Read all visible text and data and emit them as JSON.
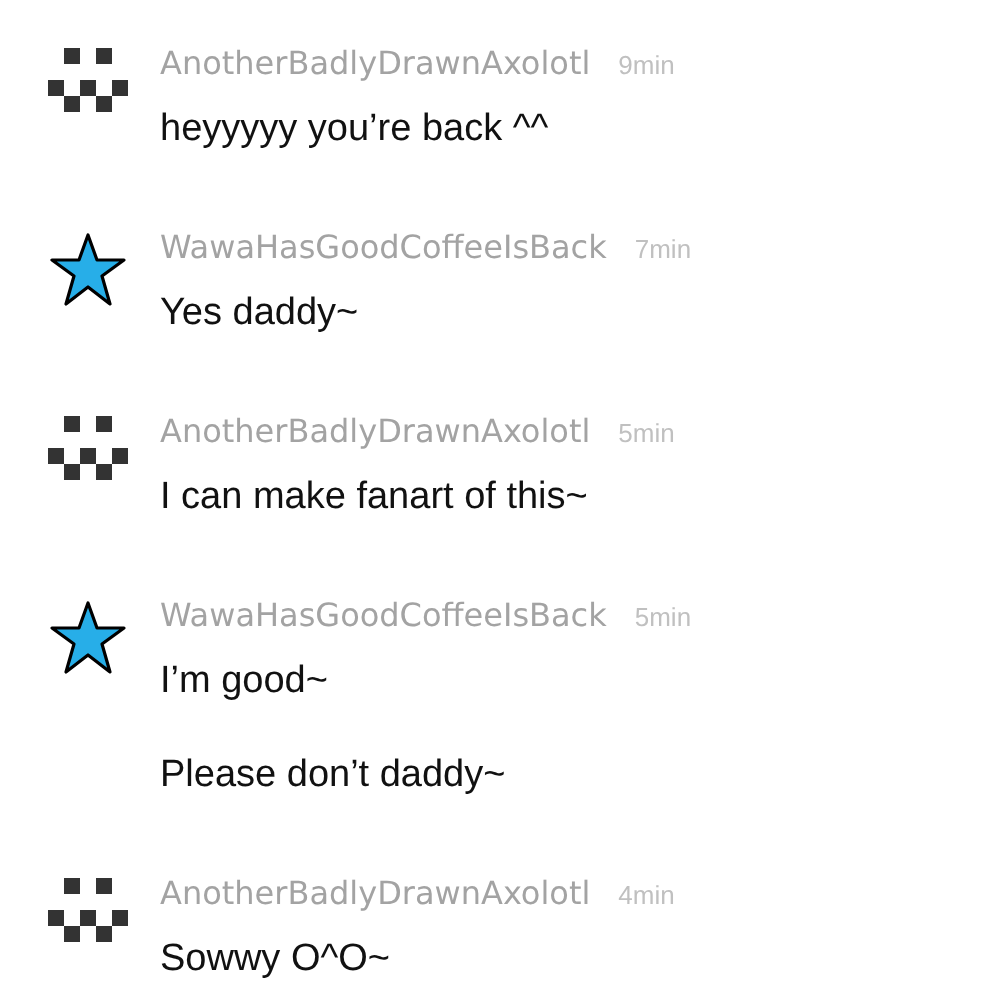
{
  "messages": [
    {
      "kind": "pixel",
      "author": "AnotherBadlyDrawnAxolotl",
      "time": "9min",
      "lines": [
        "heyyyyy you’re back ^^"
      ]
    },
    {
      "kind": "star",
      "author": "WawaHasGoodCoffeeIsBack",
      "time": "7min",
      "lines": [
        "Yes daddy~"
      ]
    },
    {
      "kind": "pixel",
      "author": "AnotherBadlyDrawnAxolotl",
      "time": "5min",
      "lines": [
        "I can make fanart of this~"
      ]
    },
    {
      "kind": "star",
      "author": "WawaHasGoodCoffeeIsBack",
      "time": "5min",
      "lines": [
        "I’m good~",
        "Please don’t daddy~"
      ]
    },
    {
      "kind": "pixel",
      "author": "AnotherBadlyDrawnAxolotl",
      "time": "4min",
      "lines": [
        "Sowwy O^O~"
      ]
    }
  ]
}
